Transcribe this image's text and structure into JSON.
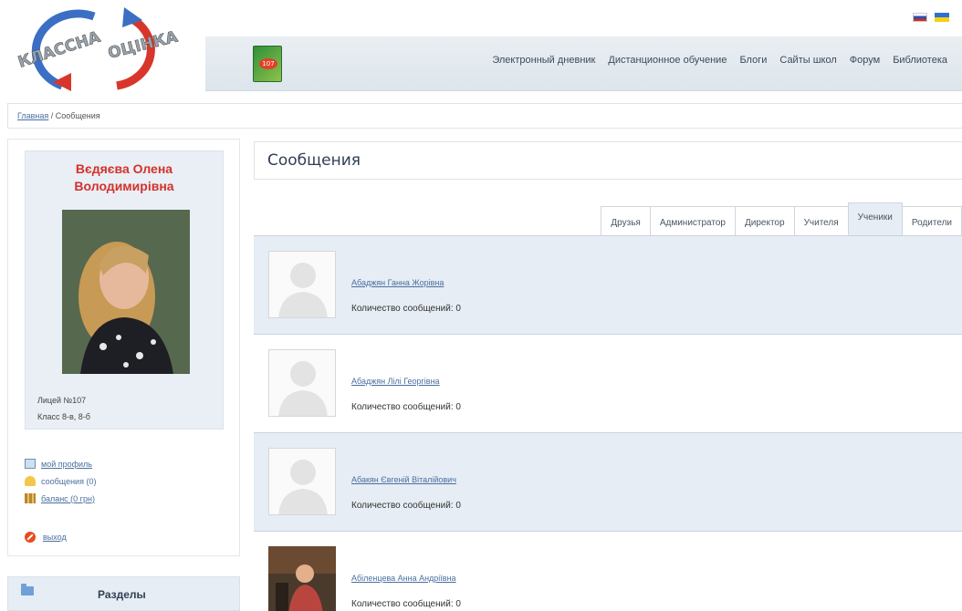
{
  "header": {
    "logo_text": "Классна оцінка",
    "book_badge": "107",
    "nav": [
      "Электронный дневник",
      "Дистанционное обучение",
      "Блоги",
      "Сайты школ",
      "Форум",
      "Библиотека"
    ]
  },
  "breadcrumb": {
    "home": "Главная",
    "separator": " / ",
    "current": "Сообщения"
  },
  "profile": {
    "name_line1": "Вєдяєва Олена",
    "name_line2": "Володимирівна",
    "school": "Лицей №107",
    "class": "Класс 8-в, 8-б"
  },
  "menu": {
    "profile": "мой профиль",
    "messages": "сообщения (0)",
    "balance": "баланс (0 грн)",
    "exit": "выход"
  },
  "sections_label": "Разделы",
  "page_title": "Сообщения",
  "tabs": [
    "Друзья",
    "Администратор",
    "Директор",
    "Учителя",
    "Ученики",
    "Родители"
  ],
  "active_tab": "Ученики",
  "people": [
    {
      "name": "Абаджян Ганна Жорівна",
      "count": "Количество сообщений: 0",
      "photo": false
    },
    {
      "name": "Абаджян Лілі Георгівна",
      "count": "Количество сообщений: 0",
      "photo": false
    },
    {
      "name": "Абакян Євгеній Віталійович",
      "count": "Количество сообщений: 0",
      "photo": false
    },
    {
      "name": "Абіленцева Анна Андріївна",
      "count": "Количество сообщений: 0",
      "photo": true
    }
  ],
  "colors": {
    "accent_name": "#d3312b",
    "link": "#4a6fa0",
    "row_shade": "#e6edf4"
  }
}
